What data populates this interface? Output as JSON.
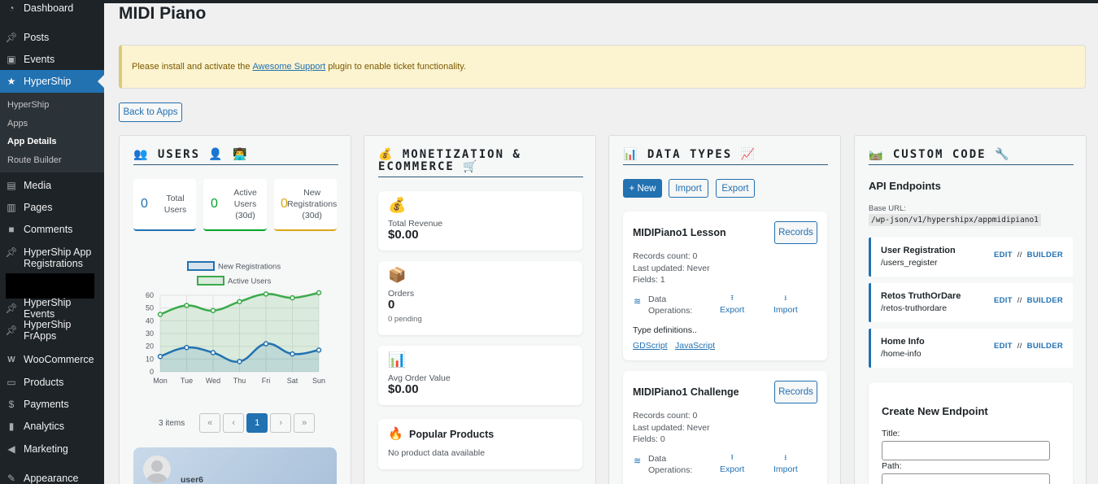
{
  "sidebar": {
    "items": [
      {
        "label": "Dashboard",
        "icon": "dashboard-icon"
      },
      {
        "label": "Posts",
        "icon": "pin-icon"
      },
      {
        "label": "Events",
        "icon": "calendar-icon"
      },
      {
        "label": "HyperShip",
        "icon": "star-icon"
      },
      {
        "label": "Media",
        "icon": "media-icon"
      },
      {
        "label": "Pages",
        "icon": "pages-icon"
      },
      {
        "label": "Comments",
        "icon": "comment-icon"
      },
      {
        "label": "HyperShip App Registrations",
        "icon": "pin-icon"
      },
      {
        "label": "HyperShip Events",
        "icon": "pin-icon"
      },
      {
        "label": "HyperShip FrApps",
        "icon": "pin-icon"
      },
      {
        "label": "WooCommerce",
        "icon": "woo-icon"
      },
      {
        "label": "Products",
        "icon": "archive-icon"
      },
      {
        "label": "Payments",
        "icon": "dollar-icon"
      },
      {
        "label": "Analytics",
        "icon": "bar-chart-icon"
      },
      {
        "label": "Marketing",
        "icon": "megaphone-icon"
      },
      {
        "label": "Appearance",
        "icon": "brush-icon"
      }
    ],
    "submenu": [
      "HyperShip",
      "Apps",
      "App Details",
      "Route Builder"
    ]
  },
  "page": {
    "title": "MIDI Piano"
  },
  "notice": {
    "before": "Please install and activate the",
    "link": "Awesome Support",
    "after": "plugin to enable ticket functionality."
  },
  "back_button": "Back to Apps",
  "users": {
    "heading": "👥 USERS 👤 👨‍💻",
    "stats": [
      {
        "value": "0",
        "label": "Total Users",
        "color": "#2271b1"
      },
      {
        "value": "0",
        "label": "Active Users (30d)",
        "color": "#00a32a"
      },
      {
        "value": "0",
        "label": "New Registrations (30d)",
        "color": "#dba617"
      }
    ],
    "pager": {
      "count": "3 items",
      "first": "«",
      "prev": "‹",
      "current": "1",
      "next": "›",
      "last": "»"
    },
    "user_card_name": "user6"
  },
  "chart_data": {
    "type": "line",
    "categories": [
      "Mon",
      "Tue",
      "Wed",
      "Thu",
      "Fri",
      "Sat",
      "Sun"
    ],
    "ylim": [
      0,
      60
    ],
    "yticks": [
      "0",
      "10",
      "20",
      "30",
      "40",
      "50",
      "60"
    ],
    "legend_position": "top",
    "series": [
      {
        "name": "New Registrations",
        "values": [
          12,
          19,
          15,
          8,
          22,
          14,
          17
        ],
        "color": "#2271b1"
      },
      {
        "name": "Active Users",
        "values": [
          45,
          52,
          48,
          55,
          61,
          58,
          62
        ],
        "color": "#3aaa4a"
      }
    ]
  },
  "monetization": {
    "heading": "💰 MONETIZATION & ECOMMERCE 🛒",
    "cards": [
      {
        "icon": "💰",
        "label": "Total Revenue",
        "value": "$0.00",
        "sub": ""
      },
      {
        "icon": "📦",
        "label": "Orders",
        "value": "0",
        "sub": "0 pending"
      },
      {
        "icon": "📊",
        "label": "Avg Order Value",
        "value": "$0.00",
        "sub": ""
      }
    ],
    "popular": {
      "icon": "🔥",
      "title": "Popular Products",
      "text": "No product data available"
    }
  },
  "datatypes": {
    "heading": "📊 DATA TYPES 📈",
    "new_btn": "+ New",
    "import_btn": "Import",
    "export_btn": "Export",
    "items": [
      {
        "title": "MIDIPiano1 Lesson",
        "records_btn": "Records",
        "count": "Records count: 0",
        "updated": "Last updated: Never",
        "fields": "Fields: 1",
        "ops_label": "Data Operations:",
        "export": "Export",
        "import": "Import",
        "typedefs": "Type definitions..",
        "gd": "GDScript",
        "js": "JavaScript"
      },
      {
        "title": "MIDIPiano1 Challenge",
        "records_btn": "Records",
        "count": "Records count: 0",
        "updated": "Last updated: Never",
        "fields": "Fields: 0",
        "ops_label": "Data Operations:",
        "export": "Export",
        "import": "Import"
      }
    ]
  },
  "custom": {
    "heading": "🛤️ CUSTOM CODE 🔧",
    "api_title": "API Endpoints",
    "base_url_label": "Base URL:",
    "base_url": "/wp-json/v1/hypershipx/appmidipiano1",
    "endpoints": [
      {
        "name": "User Registration",
        "path": "/users_register"
      },
      {
        "name": "Retos TruthOrDare",
        "path": "/retos-truthordare"
      },
      {
        "name": "Home Info",
        "path": "/home-info"
      }
    ],
    "edit": "EDIT",
    "sep": "//",
    "builder": "BUILDER",
    "create_title": "Create New Endpoint",
    "title_label": "Title:",
    "path_label": "Path:"
  }
}
